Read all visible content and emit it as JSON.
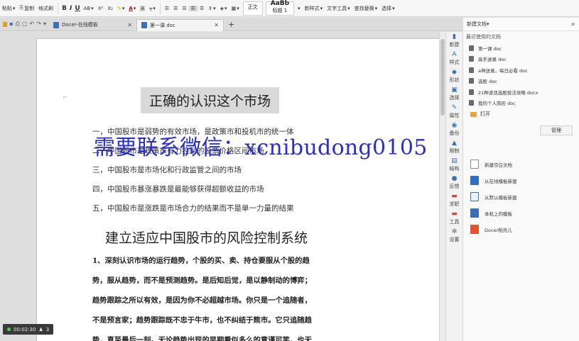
{
  "ribbon": {
    "paste": "粘贴",
    "copy": "复制",
    "format_painter": "格式刷",
    "bold": "B",
    "italic": "I",
    "underline": "U",
    "ab": "AB",
    "superscript": "X²",
    "subscript": "X₂",
    "font_color": "A",
    "char_shading": "A",
    "style_normal": "正文",
    "style_heading1": "标题 1",
    "style_preview": "AaBb",
    "new_style": "新样式",
    "text_tools": "文字工具",
    "find_replace": "查找替换",
    "select": "选择"
  },
  "tabs": [
    {
      "label": "Docer-在线模板"
    },
    {
      "label": "第一课 doc"
    }
  ],
  "document": {
    "title": "正确的认识这个市场",
    "list_items": [
      "一，中国股市是弱势的有效市场，是政策市和投机市的统一体",
      "二，中国股市是政策市有力控制的股票价格区间市场",
      "三，中国股市是市场化和行政监管之间的市场",
      "四，中国股市暴涨暴跌是最能够获得超额收益的市场",
      "五，中国股市是涨跌是市场合力的结果而不是单一力量的结果"
    ],
    "section_title": "建立适应中国股市的风险控制系统",
    "paragraph_lines": [
      "1、深刻认识市场的运行趋势，个股的买、卖、持仓要服从个股的趋",
      "势，服从趋势，而不是预测趋势。是后知后觉，是以静制动的博弈；",
      "趋势跟踪之所以有效，是因为你不必超越市场。你只是一个追随者，",
      "不是预言家；趋势跟踪既不忠于牛市，也不纠结于熊市。它只追随趋",
      "势，直至最后一刻。无论趋势出现的早期看似多么的意谨可笑，也无"
    ]
  },
  "watermark": "需要联系微信：xcnibudong0105",
  "recording": {
    "time": "00:02:30",
    "count": "3"
  },
  "sidebar_buttons": [
    "新建",
    "样式",
    "形状",
    "选择",
    "属性",
    "备份",
    "限制",
    "结构",
    "反馈",
    "求职",
    "工具",
    "设置"
  ],
  "panel": {
    "title": "新建文档",
    "recent_header": "最近使用的文档",
    "recent_docs": [
      "第一课 doc",
      "高手送录 doc",
      "a神送录，每日必看 doc",
      "选股 doc",
      "21种波浪选股技法攻略 docx",
      "我的个人简历 doc"
    ],
    "open_label": "打开",
    "manage_label": "管理",
    "new_items": [
      "新建空白文档",
      "从在线模板新建",
      "从默认模板新建",
      "本机上的模板",
      "Docer稻壳儿"
    ]
  }
}
